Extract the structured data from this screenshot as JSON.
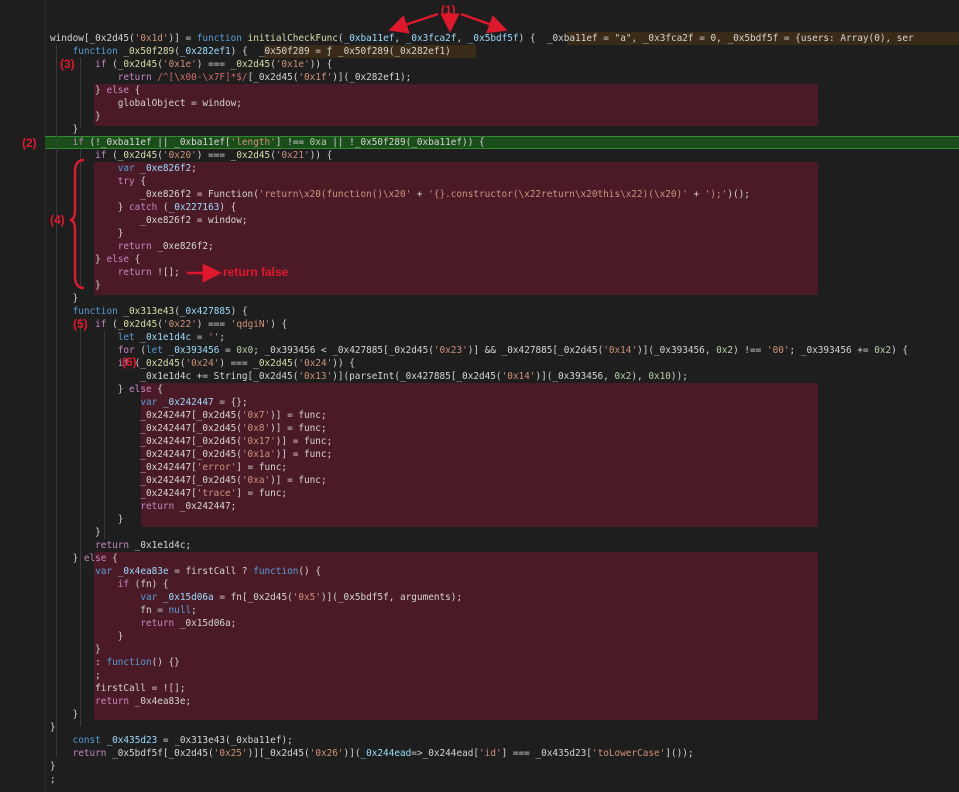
{
  "colors": {
    "background": "#1e1e1e",
    "keyword": "#569cd6",
    "function": "#dcdcaa",
    "string": "#ce9178",
    "number": "#b5cea8",
    "variable": "#9cdcfe",
    "highlight_block": "#4b1a27",
    "highlight_line": "#1b4d1b",
    "annotation": "#e0182d"
  },
  "annotations": {
    "m1": "(1)",
    "m2": "(2)",
    "m3": "(3)",
    "m4": "(4)",
    "m5": "(5)",
    "m6": "(6)",
    "return_false": "return false"
  },
  "code": [
    [
      [
        "t",
        "window[_0x2d45("
      ],
      [
        "s",
        "'0x1d'"
      ],
      [
        "t",
        ")] = "
      ],
      [
        "k",
        "function"
      ],
      [
        "t",
        " "
      ],
      [
        "f",
        "initialCheckFunc"
      ],
      [
        "t",
        "("
      ],
      [
        "v",
        "_0xba11ef"
      ],
      [
        "t",
        ", "
      ],
      [
        "v",
        "_0x3fca2f"
      ],
      [
        "t",
        ", "
      ],
      [
        "v",
        "_0x5bdf5f"
      ],
      [
        "t",
        ") {  "
      ],
      [
        "t",
        "_0xba11ef = \"a\", _0x3fca2f = 0, _0x5bdf5f = {users: Array(0), ser"
      ]
    ],
    [
      [
        "t",
        "    "
      ],
      [
        "k",
        "function"
      ],
      [
        "t",
        " "
      ],
      [
        "f",
        "_0x50f289"
      ],
      [
        "t",
        "("
      ],
      [
        "v",
        "_0x282ef1"
      ],
      [
        "t",
        ") {  "
      ],
      [
        "t",
        "_0x50f289 = ƒ _0x50f289(_0x282ef1)"
      ]
    ],
    [
      [
        "t",
        "        "
      ],
      [
        "p",
        "if"
      ],
      [
        "t",
        " ("
      ],
      [
        "f",
        "_0x2d45"
      ],
      [
        "t",
        "("
      ],
      [
        "s",
        "'0x1e'"
      ],
      [
        "t",
        ") === "
      ],
      [
        "f",
        "_0x2d45"
      ],
      [
        "t",
        "("
      ],
      [
        "s",
        "'0x1e'"
      ],
      [
        "t",
        ")) {"
      ]
    ],
    [
      [
        "t",
        "            "
      ],
      [
        "p",
        "return"
      ],
      [
        "t",
        " "
      ],
      [
        "r",
        "/^[\\x00-\\x7F]*$/"
      ],
      [
        "t",
        "[_0x2d45("
      ],
      [
        "s",
        "'0x1f'"
      ],
      [
        "t",
        ")](_0x282ef1);"
      ]
    ],
    [
      [
        "t",
        "        } "
      ],
      [
        "p",
        "else"
      ],
      [
        "t",
        " {"
      ]
    ],
    [
      [
        "t",
        "            globalObject = window;"
      ]
    ],
    [
      [
        "t",
        "        }"
      ]
    ],
    [
      [
        "t",
        "    }"
      ]
    ],
    [
      [
        "t",
        "    "
      ],
      [
        "p",
        "if"
      ],
      [
        "t",
        " (!_0xba11ef || _0xba11ef["
      ],
      [
        "s",
        "'length'"
      ],
      [
        "t",
        "] !== "
      ],
      [
        "n",
        "0xa"
      ],
      [
        "t",
        " || !_0x50f289(_0xba11ef)) {"
      ]
    ],
    [
      [
        "t",
        "        "
      ],
      [
        "p",
        "if"
      ],
      [
        "t",
        " ("
      ],
      [
        "f",
        "_0x2d45"
      ],
      [
        "t",
        "("
      ],
      [
        "s",
        "'0x20'"
      ],
      [
        "t",
        ") === "
      ],
      [
        "f",
        "_0x2d45"
      ],
      [
        "t",
        "("
      ],
      [
        "s",
        "'0x21'"
      ],
      [
        "t",
        ")) {"
      ]
    ],
    [
      [
        "t",
        "            "
      ],
      [
        "k",
        "var"
      ],
      [
        "t",
        " "
      ],
      [
        "v",
        "_0xe826f2"
      ],
      [
        "t",
        ";"
      ]
    ],
    [
      [
        "t",
        "            "
      ],
      [
        "p",
        "try"
      ],
      [
        "t",
        " {"
      ]
    ],
    [
      [
        "t",
        "                _0xe826f2 = Function("
      ],
      [
        "s",
        "'return\\x20(function()\\x20'"
      ],
      [
        "t",
        " + "
      ],
      [
        "s",
        "'{}.constructor(\\x22return\\x20this\\x22)(\\x20)'"
      ],
      [
        "t",
        " + "
      ],
      [
        "s",
        "');'"
      ],
      [
        "t",
        ")();"
      ]
    ],
    [
      [
        "t",
        "            } "
      ],
      [
        "p",
        "catch"
      ],
      [
        "t",
        " ("
      ],
      [
        "v",
        "_0x227163"
      ],
      [
        "t",
        ") {"
      ]
    ],
    [
      [
        "t",
        "                _0xe826f2 = window;"
      ]
    ],
    [
      [
        "t",
        "            }"
      ]
    ],
    [
      [
        "t",
        "            "
      ],
      [
        "p",
        "return"
      ],
      [
        "t",
        " _0xe826f2;"
      ]
    ],
    [
      [
        "t",
        "        } "
      ],
      [
        "p",
        "else"
      ],
      [
        "t",
        " {"
      ]
    ],
    [
      [
        "t",
        "            "
      ],
      [
        "p",
        "return"
      ],
      [
        "t",
        " ![];"
      ]
    ],
    [
      [
        "t",
        "        }"
      ]
    ],
    [
      [
        "t",
        "    }"
      ]
    ],
    [
      [
        "t",
        "    "
      ],
      [
        "k",
        "function"
      ],
      [
        "t",
        " "
      ],
      [
        "f",
        "_0x313e43"
      ],
      [
        "t",
        "("
      ],
      [
        "v",
        "_0x427885"
      ],
      [
        "t",
        ") {"
      ]
    ],
    [
      [
        "t",
        "        "
      ],
      [
        "p",
        "if"
      ],
      [
        "t",
        " ("
      ],
      [
        "f",
        "_0x2d45"
      ],
      [
        "t",
        "("
      ],
      [
        "s",
        "'0x22'"
      ],
      [
        "t",
        ") === "
      ],
      [
        "s",
        "'qdgiN'"
      ],
      [
        "t",
        ") {"
      ]
    ],
    [
      [
        "t",
        "            "
      ],
      [
        "k",
        "let"
      ],
      [
        "t",
        " "
      ],
      [
        "v",
        "_0x1e1d4c"
      ],
      [
        "t",
        " = "
      ],
      [
        "s",
        "''"
      ],
      [
        "t",
        ";"
      ]
    ],
    [
      [
        "t",
        "            "
      ],
      [
        "p",
        "for"
      ],
      [
        "t",
        " ("
      ],
      [
        "k",
        "let"
      ],
      [
        "t",
        " "
      ],
      [
        "v",
        "_0x393456"
      ],
      [
        "t",
        " = "
      ],
      [
        "n",
        "0x0"
      ],
      [
        "t",
        "; _0x393456 < _0x427885[_0x2d45("
      ],
      [
        "s",
        "'0x23'"
      ],
      [
        "t",
        ")] && _0x427885[_0x2d45("
      ],
      [
        "s",
        "'0x14'"
      ],
      [
        "t",
        ")](_0x393456, "
      ],
      [
        "n",
        "0x2"
      ],
      [
        "t",
        ") !== "
      ],
      [
        "s",
        "'00'"
      ],
      [
        "t",
        "; _0x393456 += "
      ],
      [
        "n",
        "0x2"
      ],
      [
        "t",
        ") {"
      ]
    ],
    [
      [
        "t",
        "            "
      ],
      [
        "p",
        "if"
      ],
      [
        "t",
        " ("
      ],
      [
        "f",
        "_0x2d45"
      ],
      [
        "t",
        "("
      ],
      [
        "s",
        "'0x24'"
      ],
      [
        "t",
        ") === "
      ],
      [
        "f",
        "_0x2d45"
      ],
      [
        "t",
        "("
      ],
      [
        "s",
        "'0x24'"
      ],
      [
        "t",
        ")) {"
      ]
    ],
    [
      [
        "t",
        "                _0x1e1d4c += String[_0x2d45("
      ],
      [
        "s",
        "'0x13'"
      ],
      [
        "t",
        ")](parseInt(_0x427885[_0x2d45("
      ],
      [
        "s",
        "'0x14'"
      ],
      [
        "t",
        ")](_0x393456, "
      ],
      [
        "n",
        "0x2"
      ],
      [
        "t",
        "), "
      ],
      [
        "n",
        "0x10"
      ],
      [
        "t",
        "));"
      ]
    ],
    [
      [
        "t",
        "            } "
      ],
      [
        "p",
        "else"
      ],
      [
        "t",
        " {"
      ]
    ],
    [
      [
        "t",
        "                "
      ],
      [
        "k",
        "var"
      ],
      [
        "t",
        " "
      ],
      [
        "v",
        "_0x242447"
      ],
      [
        "t",
        " = {};"
      ]
    ],
    [
      [
        "t",
        "                _0x242447[_0x2d45("
      ],
      [
        "s",
        "'0x7'"
      ],
      [
        "t",
        ")] = func;"
      ]
    ],
    [
      [
        "t",
        "                _0x242447[_0x2d45("
      ],
      [
        "s",
        "'0x8'"
      ],
      [
        "t",
        ")] = func;"
      ]
    ],
    [
      [
        "t",
        "                _0x242447[_0x2d45("
      ],
      [
        "s",
        "'0x17'"
      ],
      [
        "t",
        ")] = func;"
      ]
    ],
    [
      [
        "t",
        "                _0x242447[_0x2d45("
      ],
      [
        "s",
        "'0x1a'"
      ],
      [
        "t",
        ")] = func;"
      ]
    ],
    [
      [
        "t",
        "                _0x242447["
      ],
      [
        "s",
        "'error'"
      ],
      [
        "t",
        "] = func;"
      ]
    ],
    [
      [
        "t",
        "                _0x242447[_0x2d45("
      ],
      [
        "s",
        "'0xa'"
      ],
      [
        "t",
        ")] = func;"
      ]
    ],
    [
      [
        "t",
        "                _0x242447["
      ],
      [
        "s",
        "'trace'"
      ],
      [
        "t",
        "] = func;"
      ]
    ],
    [
      [
        "t",
        "                "
      ],
      [
        "p",
        "return"
      ],
      [
        "t",
        " _0x242447;"
      ]
    ],
    [
      [
        "t",
        "            }"
      ]
    ],
    [
      [
        "t",
        "        }"
      ]
    ],
    [
      [
        "t",
        "        "
      ],
      [
        "p",
        "return"
      ],
      [
        "t",
        " _0x1e1d4c;"
      ]
    ],
    [
      [
        "t",
        "    } "
      ],
      [
        "p",
        "else"
      ],
      [
        "t",
        " {"
      ]
    ],
    [
      [
        "t",
        "        "
      ],
      [
        "k",
        "var"
      ],
      [
        "t",
        " "
      ],
      [
        "v",
        "_0x4ea83e"
      ],
      [
        "t",
        " = firstCall ? "
      ],
      [
        "k",
        "function"
      ],
      [
        "t",
        "() {"
      ]
    ],
    [
      [
        "t",
        "            "
      ],
      [
        "p",
        "if"
      ],
      [
        "t",
        " (fn) {"
      ]
    ],
    [
      [
        "t",
        "                "
      ],
      [
        "k",
        "var"
      ],
      [
        "t",
        " "
      ],
      [
        "v",
        "_0x15d06a"
      ],
      [
        "t",
        " = fn[_0x2d45("
      ],
      [
        "s",
        "'0x5'"
      ],
      [
        "t",
        ")](_0x5bdf5f, arguments);"
      ]
    ],
    [
      [
        "t",
        "                fn = "
      ],
      [
        "k",
        "null"
      ],
      [
        "t",
        ";"
      ]
    ],
    [
      [
        "t",
        "                "
      ],
      [
        "p",
        "return"
      ],
      [
        "t",
        " _0x15d06a;"
      ]
    ],
    [
      [
        "t",
        "            }"
      ]
    ],
    [
      [
        "t",
        "        }"
      ]
    ],
    [
      [
        "t",
        "        : "
      ],
      [
        "k",
        "function"
      ],
      [
        "t",
        "() {}"
      ]
    ],
    [
      [
        "t",
        "        ;"
      ]
    ],
    [
      [
        "t",
        "        firstCall = ![];"
      ]
    ],
    [
      [
        "t",
        "        "
      ],
      [
        "p",
        "return"
      ],
      [
        "t",
        " _0x4ea83e;"
      ]
    ],
    [
      [
        "t",
        "    }"
      ]
    ],
    [
      [
        "t",
        "}"
      ]
    ],
    [
      [
        "t",
        "    "
      ],
      [
        "k",
        "const"
      ],
      [
        "t",
        " "
      ],
      [
        "v",
        "_0x435d23"
      ],
      [
        "t",
        " = _0x313e43(_0xba11ef);"
      ]
    ],
    [
      [
        "t",
        "    "
      ],
      [
        "p",
        "return"
      ],
      [
        "t",
        " _0x5bdf5f[_0x2d45("
      ],
      [
        "s",
        "'0x25'"
      ],
      [
        "t",
        ")][_0x2d45("
      ],
      [
        "s",
        "'0x26'"
      ],
      [
        "t",
        ")]("
      ],
      [
        "v",
        "_0x244ead"
      ],
      [
        "t",
        "=>_0x244ead["
      ],
      [
        "s",
        "'id'"
      ],
      [
        "t",
        "] === _0x435d23["
      ],
      [
        "s",
        "'toLowerCase'"
      ],
      [
        "t",
        "]());"
      ]
    ],
    [
      [
        "t",
        "}"
      ]
    ],
    [
      [
        "t",
        ";"
      ]
    ]
  ]
}
